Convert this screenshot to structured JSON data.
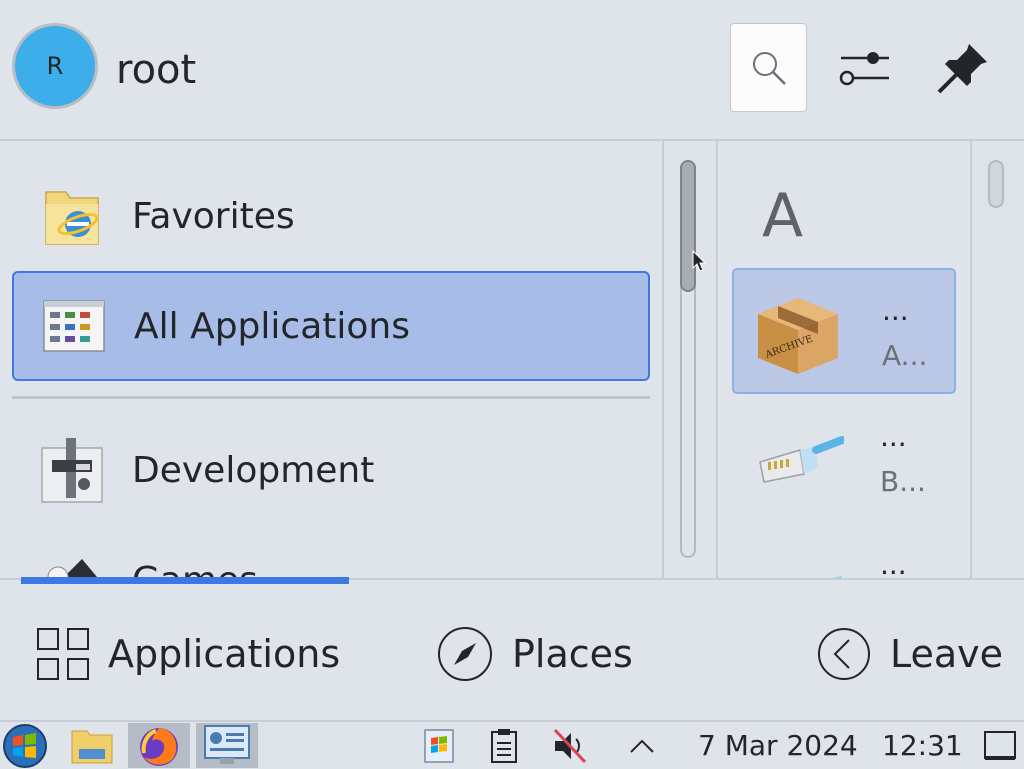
{
  "header": {
    "avatar_initial": "R",
    "username": "root",
    "search_icon": "search-icon",
    "settings_icon": "settings-sliders-icon",
    "pin_icon": "pin-icon"
  },
  "categories": [
    {
      "label": "Favorites",
      "icon": "favorites-folder-icon",
      "active": false
    },
    {
      "label": "All Applications",
      "icon": "all-applications-icon",
      "active": true
    },
    {
      "label": "Development",
      "icon": "development-icon",
      "active": false
    },
    {
      "label": "Games",
      "icon": "games-icon",
      "active": false
    }
  ],
  "apps": {
    "section_letter": "A",
    "items": [
      {
        "title": "...",
        "subtitle": "A...",
        "icon": "archive-box-icon",
        "active": true
      },
      {
        "title": "...",
        "subtitle": "B...",
        "icon": "network-cable-icon",
        "active": false
      },
      {
        "title": "...",
        "subtitle": "",
        "icon": "app-icon",
        "active": false
      }
    ]
  },
  "footer": {
    "applications_label": "Applications",
    "places_label": "Places",
    "leave_label": "Leave"
  },
  "taskbar": {
    "date": "7 Mar 2024",
    "time": "12:31"
  },
  "colors": {
    "accent": "#3d79e1",
    "selected_bg": "#a8bce8",
    "panel_bg": "#dfe3ea",
    "avatar": "#3daee9"
  }
}
